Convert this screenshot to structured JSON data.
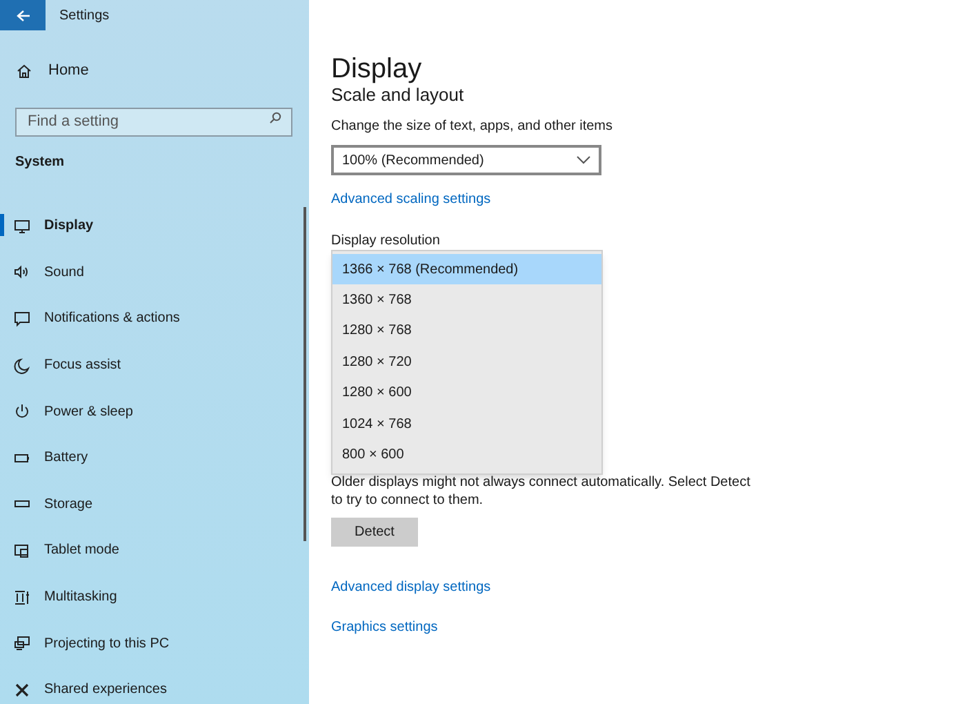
{
  "window": {
    "title": "Settings"
  },
  "sidebar": {
    "home": "Home",
    "search": {
      "placeholder": "Find a setting"
    },
    "section": "System",
    "items": [
      {
        "label": "Display",
        "selected": true
      },
      {
        "label": "Sound",
        "selected": false
      },
      {
        "label": "Notifications & actions",
        "selected": false
      },
      {
        "label": "Focus assist",
        "selected": false
      },
      {
        "label": "Power & sleep",
        "selected": false
      },
      {
        "label": "Battery",
        "selected": false
      },
      {
        "label": "Storage",
        "selected": false
      },
      {
        "label": "Tablet mode",
        "selected": false
      },
      {
        "label": "Multitasking",
        "selected": false
      },
      {
        "label": "Projecting to this PC",
        "selected": false
      },
      {
        "label": "Shared experiences",
        "selected": false
      }
    ]
  },
  "main": {
    "title": "Display",
    "section": "Scale and layout",
    "scale_label": "Change the size of text, apps, and other items",
    "scale_value": "100% (Recommended)",
    "scaling_link": "Advanced scaling settings",
    "resolution_label": "Display resolution",
    "resolution_options": [
      {
        "label": "1366 × 768 (Recommended)",
        "selected": true
      },
      {
        "label": "1360 × 768",
        "selected": false
      },
      {
        "label": "1280 × 768",
        "selected": false
      },
      {
        "label": "1280 × 720",
        "selected": false
      },
      {
        "label": "1280 × 600",
        "selected": false
      },
      {
        "label": "1024 × 768",
        "selected": false
      },
      {
        "label": "800 × 600",
        "selected": false
      }
    ],
    "detect_note": "Older displays might not always connect automatically. Select Detect to try to connect to them.",
    "detect_button": "Detect",
    "links": [
      "Advanced display settings",
      "Graphics settings"
    ]
  }
}
